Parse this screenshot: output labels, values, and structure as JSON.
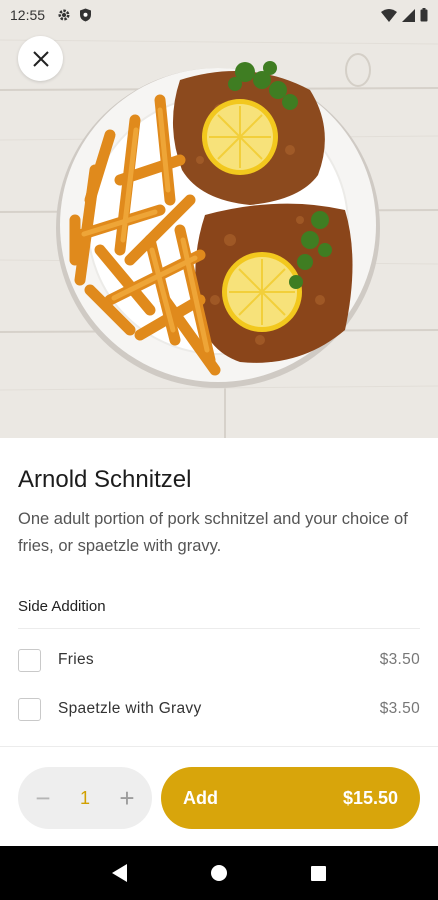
{
  "status_bar": {
    "time": "12:55",
    "left_icons": [
      "gear-icon",
      "shield-icon"
    ],
    "right_icons": [
      "wifi-icon",
      "signal-icon",
      "battery-icon"
    ]
  },
  "header": {
    "close_icon": "close-icon",
    "hero_image": "schnitzel-plate-photo"
  },
  "item": {
    "title": "Arnold Schnitzel",
    "description": "One adult portion of pork schnitzel and your choice of fries, or spaetzle with gravy."
  },
  "side_addition": {
    "title": "Side Addition",
    "options": [
      {
        "label": "Fries",
        "price": "$3.50",
        "checked": false
      },
      {
        "label": "Spaetzle with Gravy",
        "price": "$3.50",
        "checked": false
      }
    ]
  },
  "footer": {
    "quantity": "1",
    "minus_label": "−",
    "plus_label": "+",
    "add_label": "Add",
    "add_price": "$15.50"
  },
  "colors": {
    "accent": "#d8a50b",
    "quantity_text": "#d1a000"
  },
  "nav": {
    "icons": [
      "back-icon",
      "home-icon",
      "recents-icon"
    ]
  }
}
